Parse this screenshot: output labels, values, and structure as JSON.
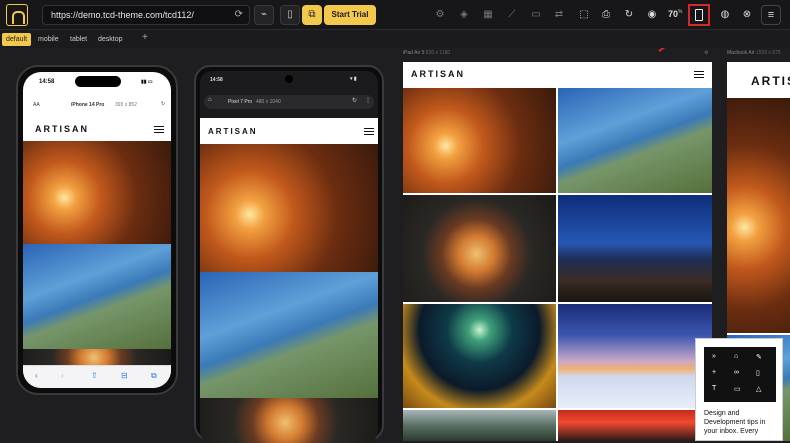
{
  "toolbar": {
    "url": "https://demo.tcd-theme.com/tcd112/",
    "start_trial_label": "Start Trial",
    "zoom_value": "70",
    "zoom_unit": "%",
    "accent_color": "#f2c94c",
    "highlight_color": "#d32a2a"
  },
  "tabs": [
    {
      "label": "default",
      "active": true
    },
    {
      "label": "mobile",
      "active": false
    },
    {
      "label": "tablet",
      "active": false
    },
    {
      "label": "desktop",
      "active": false
    }
  ],
  "devices": {
    "iphone": {
      "status_time": "14:58",
      "aa": "AA",
      "model": "iPhone 14 Pro",
      "size": "393 x 852"
    },
    "pixel": {
      "status_time": "14:58",
      "model": "Pixel 7 Pro",
      "size": "480 x 1040"
    },
    "ipad": {
      "label": "iPad Air 5",
      "size": "820 x 1180"
    },
    "macbook": {
      "label": "Macbook Air",
      "size": "1559 x 975"
    }
  },
  "site": {
    "brand": "ARTISAN"
  },
  "popup": {
    "text": "Design and Development tips in your inbox. Every"
  }
}
